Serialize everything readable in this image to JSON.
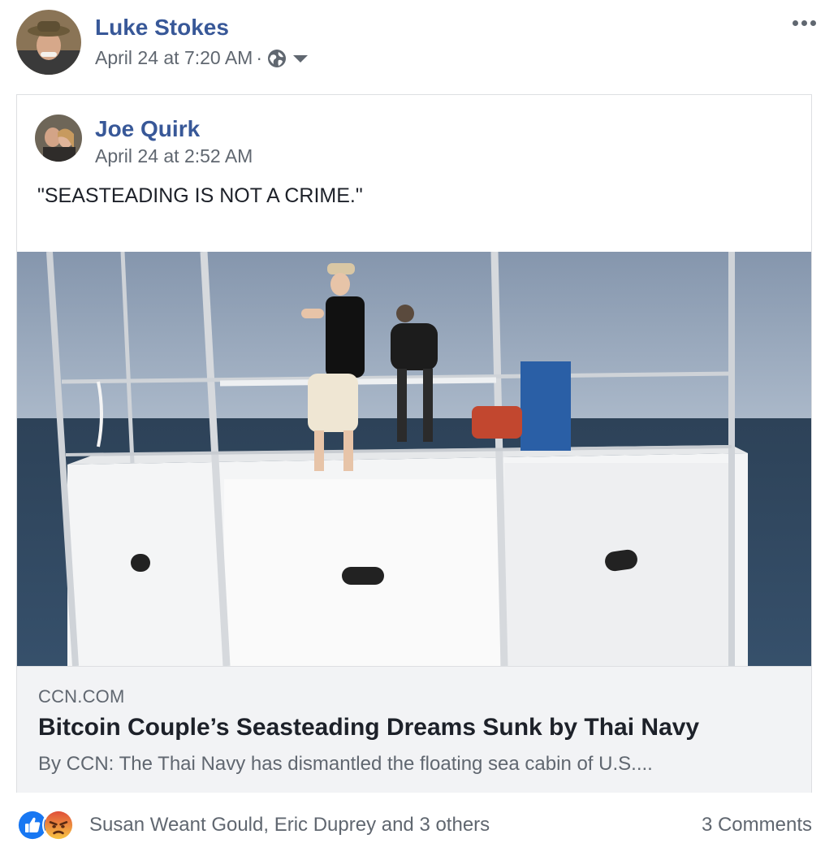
{
  "post": {
    "author": "Luke Stokes",
    "timestamp": "April 24 at 7:20 AM",
    "separator": "·",
    "privacy_icon": "globe-icon",
    "audience_caret_icon": "caret-down-icon",
    "options_icon": "more-options-icon"
  },
  "shared_post": {
    "author": "Joe Quirk",
    "timestamp": "April 24 at 2:52 AM",
    "text": "\"SEASTEADING IS NOT A CRIME.\""
  },
  "link_preview": {
    "domain": "CCN.COM",
    "title": "Bitcoin Couple’s Seasteading Dreams Sunk by Thai Navy",
    "description": "By CCN: The Thai Navy has dismantled the floating sea cabin of U.S...."
  },
  "footer": {
    "reaction_icons": [
      "like-icon",
      "angry-icon"
    ],
    "reaction_names": "Susan Weant Gould, Eric Duprey and 3 others",
    "comments": "3 Comments"
  },
  "colors": {
    "link_blue": "#385898",
    "secondary_text": "#606770",
    "primary_text": "#1d2129",
    "preview_bg": "#f2f3f5",
    "like_blue": "#1877f2",
    "angry_orange": "#f0703d"
  }
}
